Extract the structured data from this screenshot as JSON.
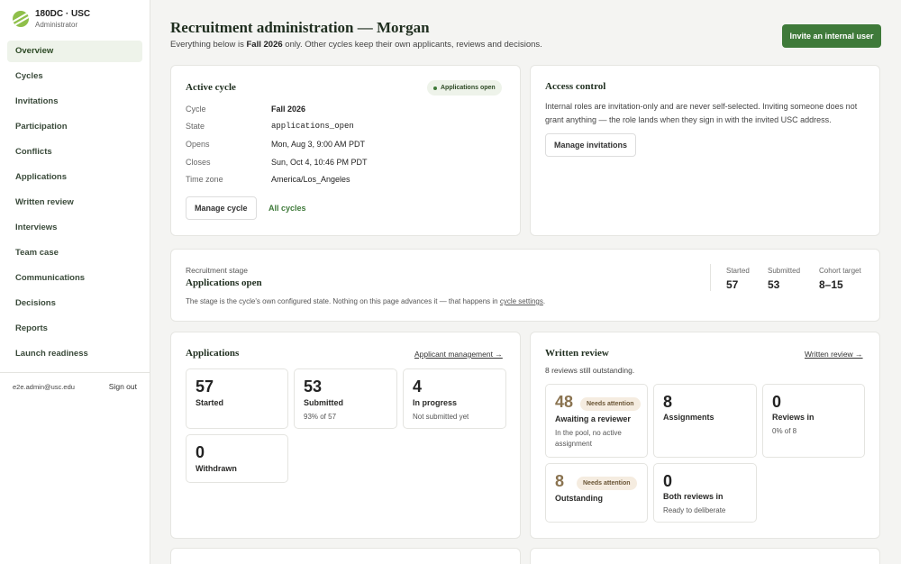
{
  "brand": {
    "name": "180DC · USC",
    "role": "Administrator"
  },
  "nav": [
    "Overview",
    "Cycles",
    "Invitations",
    "Participation",
    "Conflicts",
    "Applications",
    "Written review",
    "Interviews",
    "Team case",
    "Communications",
    "Decisions",
    "Reports",
    "Launch readiness"
  ],
  "sidebar_footer": {
    "email": "e2e.admin@usc.edu",
    "signout": "Sign out"
  },
  "header": {
    "title": "Recruitment administration — Morgan",
    "sub_prefix": "Everything below is",
    "sub_cycle": "Fall 2026",
    "sub_suffix": "only. Other cycles keep their own applicants, reviews and decisions.",
    "invite_label": "Invite an internal user"
  },
  "active_cycle": {
    "title": "Active cycle",
    "status": "Applications open",
    "rows": [
      {
        "k": "Cycle",
        "v": "Fall 2026"
      },
      {
        "k": "State",
        "v": "applications_open"
      },
      {
        "k": "Opens",
        "v": "Mon, Aug 3, 9:00 AM PDT"
      },
      {
        "k": "Closes",
        "v": "Sun, Oct 4, 10:46 PM PDT"
      },
      {
        "k": "Time zone",
        "v": "America/Los_Angeles"
      }
    ],
    "manage_label": "Manage cycle",
    "all_label": "All cycles"
  },
  "access": {
    "title": "Access control",
    "text": "Internal roles are invitation-only and are never self-selected. Inviting someone does not grant anything — the role lands when they sign in with the invited USC address.",
    "manage_label": "Manage invitations"
  },
  "stage": {
    "small": "Recruitment stage",
    "title": "Applications open",
    "note_prefix": "The stage is the cycle's own configured state. Nothing on this page advances it — that happens in",
    "note_link": "cycle settings",
    "note_suffix": ".",
    "stats": [
      {
        "label": "Started",
        "value": "57"
      },
      {
        "label": "Submitted",
        "value": "53"
      },
      {
        "label": "Cohort target",
        "value": "8–15"
      }
    ]
  },
  "applications": {
    "title": "Applications",
    "link": "Applicant management →",
    "tiles": [
      {
        "num": "57",
        "label": "Started",
        "sub": ""
      },
      {
        "num": "53",
        "label": "Submitted",
        "sub": "93% of 57"
      },
      {
        "num": "4",
        "label": "In progress",
        "sub": "Not submitted yet"
      },
      {
        "num": "0",
        "label": "Withdrawn",
        "sub": ""
      }
    ]
  },
  "written_review": {
    "title": "Written review",
    "link": "Written review →",
    "sub": "8 reviews still outstanding.",
    "tiles": [
      {
        "num": "48",
        "badge": "Needs attention",
        "label": "Awaiting a reviewer",
        "sub1": "In the pool, no active",
        "sub2": "assignment"
      },
      {
        "num": "8",
        "label": "Assignments"
      },
      {
        "num": "0",
        "label": "Reviews in",
        "sub1": "0% of 8"
      },
      {
        "num": "8",
        "badge": "Needs attention",
        "label": "Outstanding"
      },
      {
        "num": "0",
        "label": "Both reviews in",
        "sub1": "Ready to deliberate"
      }
    ]
  },
  "colors": {
    "accent": "#3f7a3a",
    "attention": "#8a7350"
  }
}
